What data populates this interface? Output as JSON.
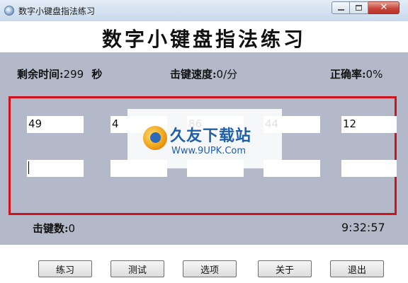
{
  "window": {
    "title": "数字小键盘指法练习",
    "close_glyph": "✕"
  },
  "header": {
    "title": "数字小键盘指法练习"
  },
  "stats": {
    "time_label": "剩余时间:",
    "time_value": "299",
    "time_unit": "秒",
    "speed_label": "击键速度:",
    "speed_value": "0/分",
    "accuracy_label": "正确率:",
    "accuracy_value": "0%"
  },
  "practice": {
    "targets": [
      "49",
      "4",
      "86",
      "44",
      "12"
    ],
    "inputs": [
      "",
      "",
      "",
      "",
      ""
    ]
  },
  "watermark": {
    "brand": "久友下载站",
    "url": "Www.9UPK.Com"
  },
  "footer": {
    "keystroke_label": "击键数:",
    "keystroke_value": "0",
    "clock": "9:32:57",
    "buttons": {
      "practice": "练习",
      "test": "测试",
      "options": "选项",
      "about": "关于",
      "exit": "退出"
    }
  },
  "icons": {
    "app": "app-icon",
    "minimize": "minimize-icon",
    "maximize": "maximize-icon",
    "close": "close-icon"
  }
}
